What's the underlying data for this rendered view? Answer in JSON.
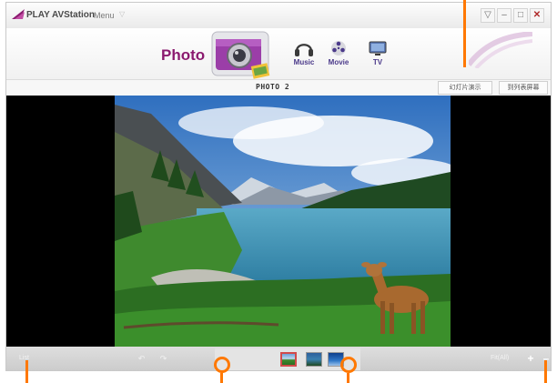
{
  "titlebar": {
    "app_name": "PLAY AVStation",
    "menu_label": "Menu",
    "menu_caret": "▽",
    "controls": {
      "dropdown": "▽",
      "minimize": "–",
      "maximize": "□",
      "close": "✕"
    }
  },
  "media_bar": {
    "current_section": "Photo",
    "tabs": [
      {
        "label": "Music",
        "icon": "headphones-icon"
      },
      {
        "label": "Movie",
        "icon": "film-reel-icon"
      },
      {
        "label": "TV",
        "icon": "tv-icon"
      }
    ]
  },
  "info_bar": {
    "photo_name": "PHOTO 2",
    "slideshow_button": "幻灯片演示",
    "list_view_button": "到列表屏幕"
  },
  "bottom_bar": {
    "list_label": "List",
    "rotate_left": "↶",
    "rotate_right": "↷",
    "zoom_label": "Fit(All)",
    "zoom_in": "+",
    "zoom_out": "–",
    "thumbnails": [
      {
        "name": "lake-mountain",
        "selected": true
      },
      {
        "name": "forest-lake",
        "selected": false
      },
      {
        "name": "blue-sky",
        "selected": false
      }
    ]
  },
  "colors": {
    "accent": "#8b1a6f",
    "callout": "#ff7800",
    "selected_thumb_border": "#d14a4a"
  }
}
